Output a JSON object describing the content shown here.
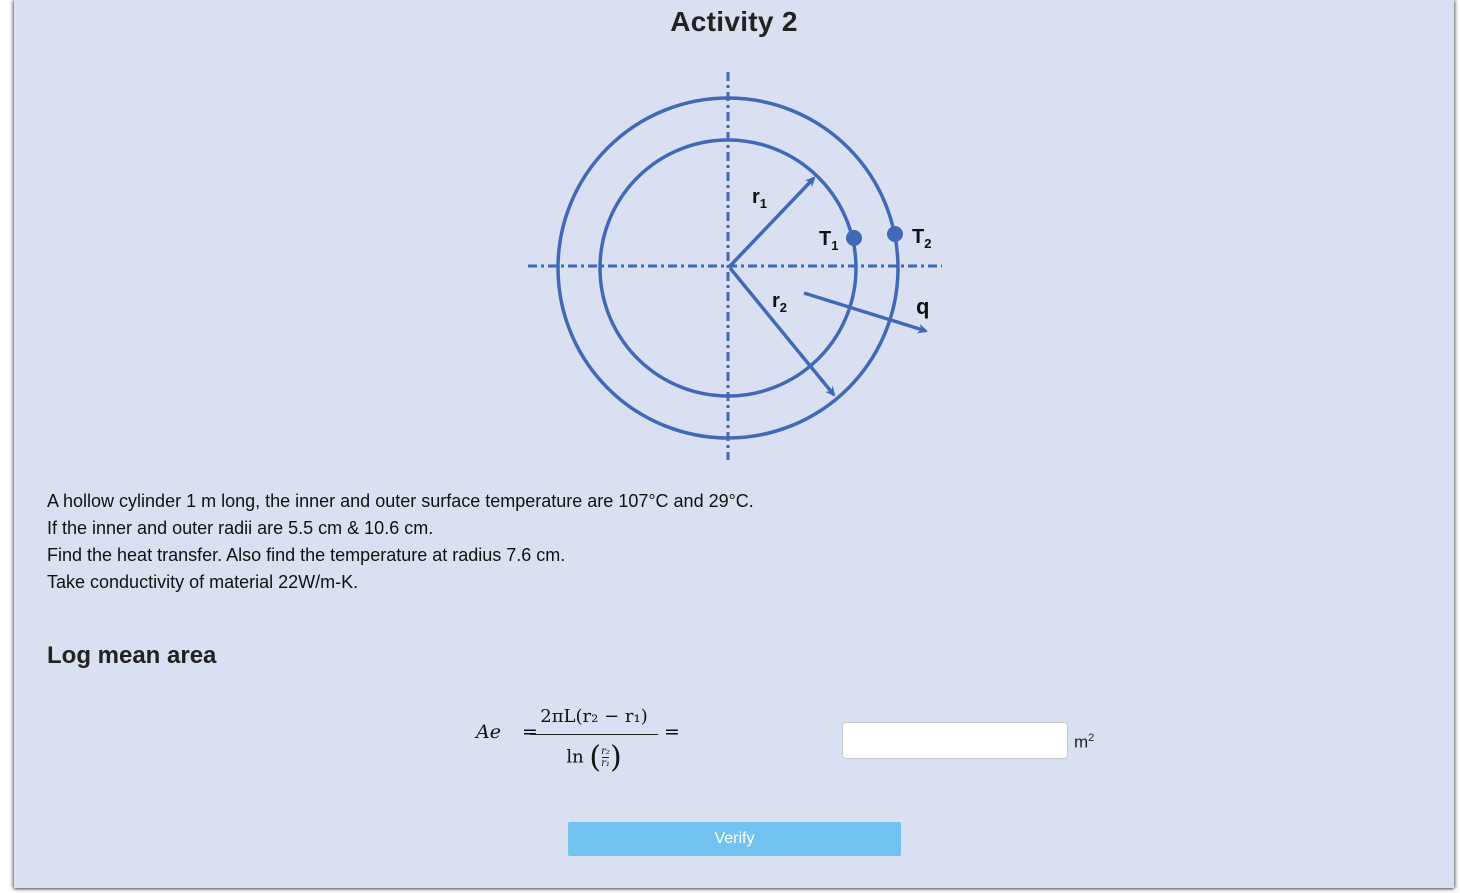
{
  "activity": {
    "title": "Activity 2"
  },
  "diagram": {
    "labels": {
      "r1": "r",
      "r1_sub": "1",
      "r2": "r",
      "r2_sub": "2",
      "t1": "T",
      "t1_sub": "1",
      "t2": "T",
      "t2_sub": "2",
      "q": "q"
    },
    "color": "#4069b8"
  },
  "problem": {
    "lines": [
      "A hollow cylinder 1 m long, the inner and outer surface temperature are 107°C and 29°C.",
      "If the inner and outer radii are 5.5 cm & 10.6 cm.",
      "Find the heat transfer. Also find the temperature at radius 7.6 cm.",
      "Take conductivity of material 22W/m-K."
    ]
  },
  "section": {
    "heading": "Log mean area"
  },
  "formula": {
    "lhs": "Ae",
    "equals": "=",
    "numerator": "2πL(r₂ − r₁)",
    "ln": "ln",
    "small_num": "r₂",
    "small_den": "r₁",
    "trailing_equals": "="
  },
  "answer": {
    "value": "",
    "placeholder": "",
    "unit": "m",
    "unit_sup": "2"
  },
  "verify_button": {
    "label": "Verify"
  }
}
